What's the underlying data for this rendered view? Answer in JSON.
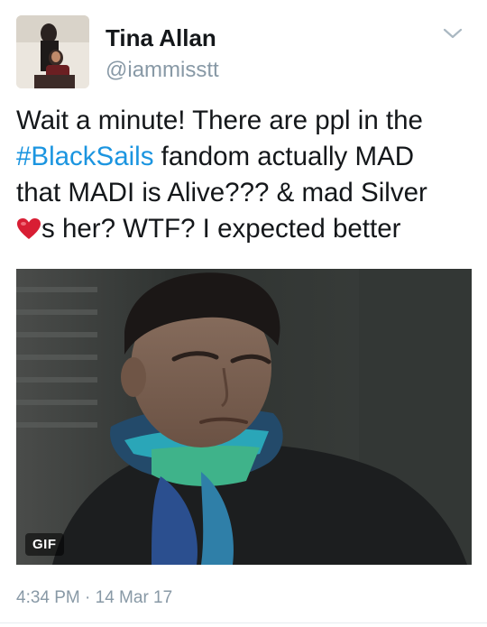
{
  "user": {
    "display_name": "Tina Allan",
    "handle": "@iammisstt",
    "avatar": "profile-photo"
  },
  "menu": {
    "icon": "chevron-down-icon"
  },
  "tweet": {
    "line1": "Wait a minute! There are ppl in the",
    "hashtag": "#BlackSails",
    "line2_rest": " fandom actually MAD",
    "line3": "that MADI is Alive???  & mad Silver",
    "heart_icon": "red-heart-emoji",
    "line4_rest": "s her? WTF? I expected better"
  },
  "media": {
    "badge": "GIF"
  },
  "meta": {
    "timestamp": "4:34 PM · 14 Mar 17"
  },
  "colors": {
    "hashtag": "#1b95e0",
    "secondary_text": "#8899a6",
    "heart": "#d81e34"
  }
}
